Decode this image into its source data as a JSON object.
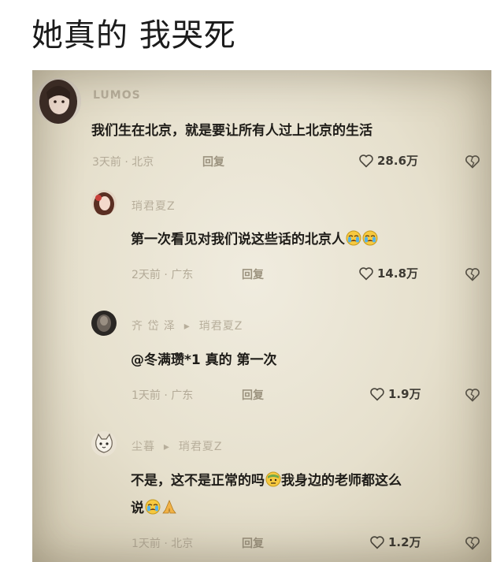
{
  "post": {
    "title": "她真的 我哭死"
  },
  "comments": [
    {
      "username": "LUMOS",
      "text": "我们生在北京，就是要让所有人过上北京的生活",
      "meta": "3天前 · 北京",
      "reply_label": "回复",
      "likes": "28.6万",
      "avatar": "avatar-girl-dark-hair"
    },
    {
      "username": "琑君夏Z",
      "text": "第一次看见对我们说这些话的北京人",
      "meta": "2天前 · 广东",
      "reply_label": "回复",
      "likes": "14.8万",
      "avatar": "avatar-girl-red",
      "emojis": [
        "crying-emoji",
        "crying-emoji"
      ]
    },
    {
      "username": "齐 岱 泽",
      "reply_to": "琑君夏Z",
      "text": "@冬满瓒*1 真的 第一次",
      "meta": "1天前 · 广东",
      "reply_label": "回复",
      "likes": "1.9万",
      "avatar": "avatar-dark"
    },
    {
      "username": "尘暮",
      "reply_to": "琑君夏Z",
      "text_line1": "不是，这不是正常的吗",
      "text_line1b": "我身边的老师都这么",
      "text_line2": "说",
      "meta": "1天前 · 北京",
      "reply_label": "回复",
      "likes": "1.2万",
      "avatar": "avatar-cat",
      "emojis": [
        "sweat-emoji",
        "crying-emoji",
        "pray-emoji"
      ]
    }
  ],
  "icons": {
    "like": "heart-outline-icon",
    "dislike": "broken-heart-icon"
  }
}
